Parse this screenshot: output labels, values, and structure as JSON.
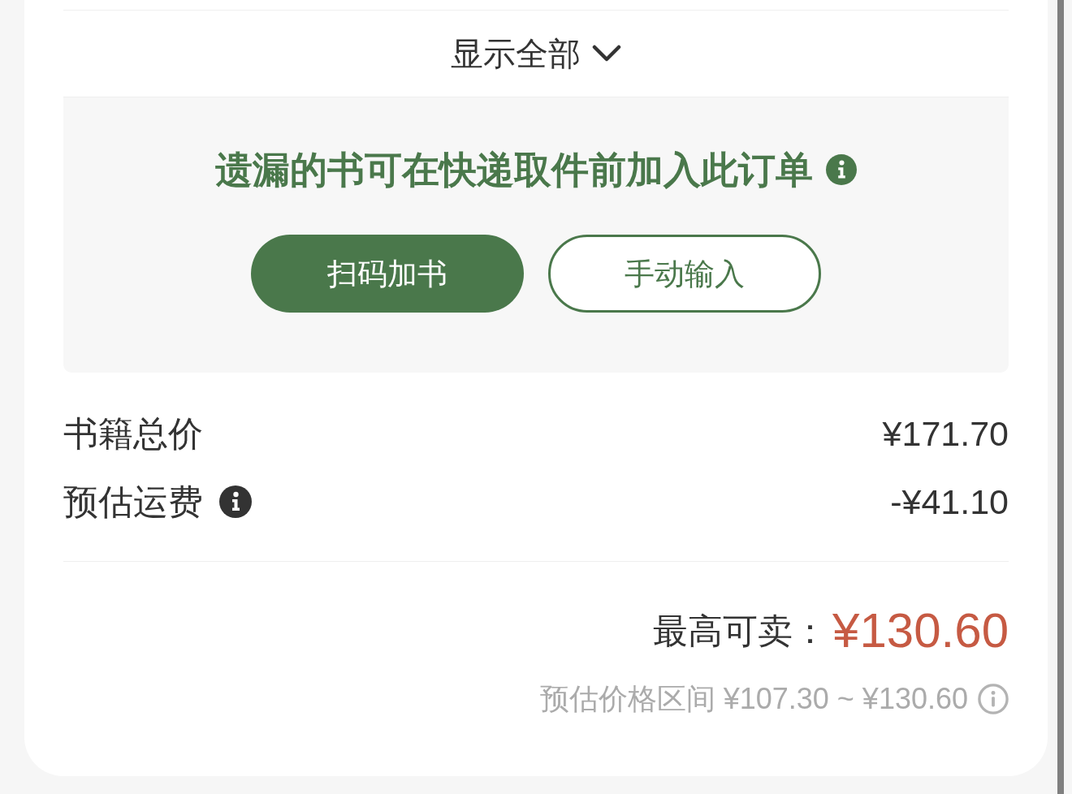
{
  "show_all": {
    "label": "显示全部"
  },
  "add_books": {
    "notice": "遗漏的书可在快递取件前加入此订单",
    "buttons": [
      {
        "label": "扫码加书",
        "kind": "primary"
      },
      {
        "label": "手动输入",
        "kind": "secondary"
      }
    ]
  },
  "summary": [
    {
      "label": "书籍总价",
      "value": "¥171.70",
      "info": false
    },
    {
      "label": "预估运费",
      "value": "-¥41.10",
      "info": true
    }
  ],
  "max_sale": {
    "label": "最高可卖：",
    "value": "¥130.60"
  },
  "estimate_range": {
    "label": "预估价格区间 ¥107.30 ~ ¥130.60"
  }
}
